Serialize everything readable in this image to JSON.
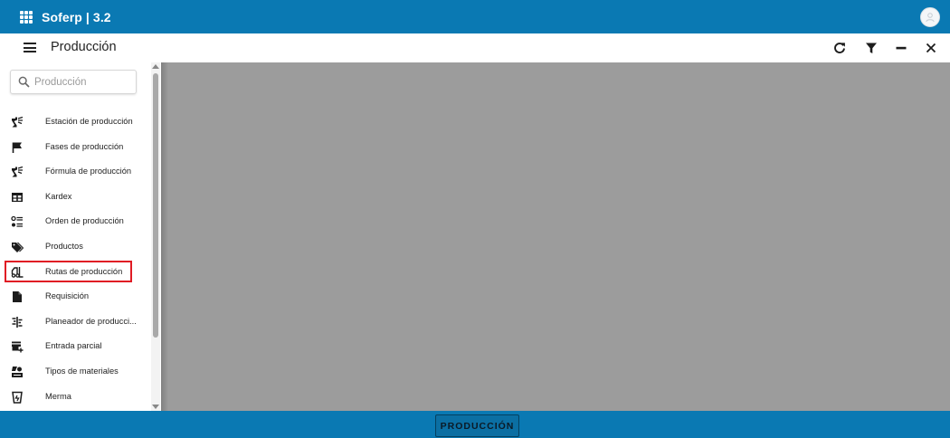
{
  "app": {
    "title": "Soferp | 3.2",
    "accent_color": "#0a79b3"
  },
  "titlebar": {
    "title": "Producción",
    "actions": [
      {
        "icon": "refresh-icon"
      },
      {
        "icon": "filter-icon"
      },
      {
        "icon": "minimize-icon"
      },
      {
        "icon": "close-icon"
      }
    ]
  },
  "sidebar": {
    "search": {
      "placeholder": "Producción",
      "value": ""
    },
    "items": [
      {
        "label": "Estación de producción",
        "icon": "production-station-icon"
      },
      {
        "label": "Fases de producción",
        "icon": "flag-icon"
      },
      {
        "label": "Fórmula de producción",
        "icon": "production-formula-icon"
      },
      {
        "label": "Kardex",
        "icon": "table-icon"
      },
      {
        "label": "Orden de producción",
        "icon": "list-order-icon"
      },
      {
        "label": "Productos",
        "icon": "tags-icon"
      },
      {
        "label": "Rutas de producción",
        "icon": "forklift-icon",
        "highlighted": true
      },
      {
        "label": "Requisición",
        "icon": "document-icon"
      },
      {
        "label": "Planeador de producci...",
        "icon": "planner-icon"
      },
      {
        "label": "Entrada parcial",
        "icon": "store-add-icon"
      },
      {
        "label": "Tipos de materiales",
        "icon": "materials-icon"
      },
      {
        "label": "Merma",
        "icon": "waste-bin-icon"
      }
    ]
  },
  "bottombar": {
    "button_label": "PRODUCCIÓN"
  }
}
